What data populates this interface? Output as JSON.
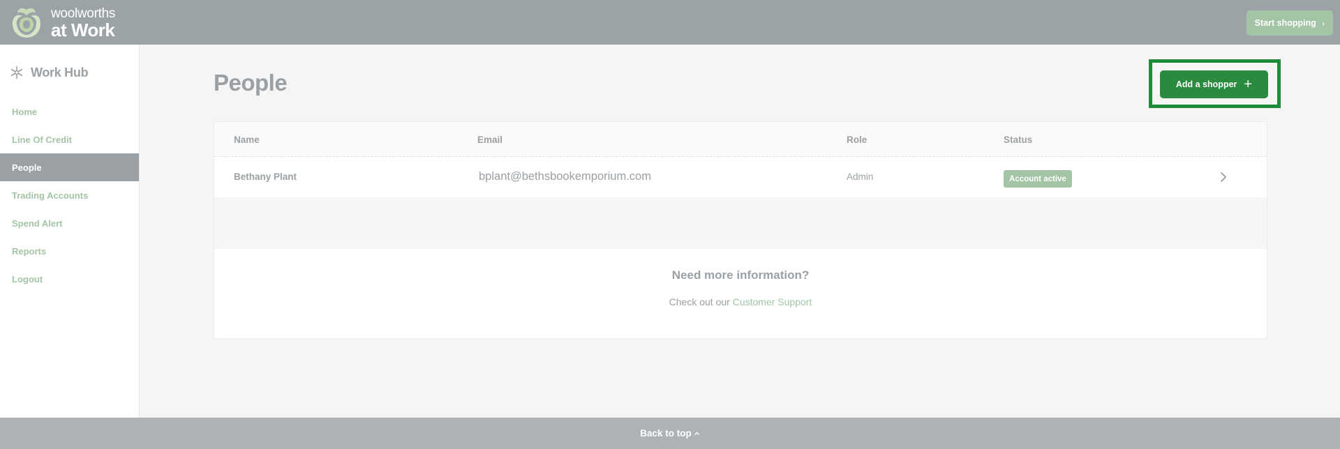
{
  "header": {
    "logo_line1": "woolworths",
    "logo_line2": "at Work",
    "start_shopping_label": "Start shopping",
    "brand_colors": {
      "header_bg": "#9ca3a6",
      "accent": "#a3c4a5"
    }
  },
  "sidebar": {
    "hub_label": "Work Hub",
    "hub_icon": "hub-icon",
    "items": [
      {
        "label": "Home",
        "active": false
      },
      {
        "label": "Line Of Credit",
        "active": false
      },
      {
        "label": "People",
        "active": true
      },
      {
        "label": "Trading Accounts",
        "active": false
      },
      {
        "label": "Spend Alert",
        "active": false
      },
      {
        "label": "Reports",
        "active": false
      },
      {
        "label": "Logout",
        "active": false
      }
    ]
  },
  "main": {
    "title": "People",
    "add_shopper_label": "Add a shopper",
    "add_shopper_icon": "plus-icon",
    "highlight_color": "#1f8a3a",
    "table": {
      "columns": [
        "Name",
        "Email",
        "Role",
        "Status"
      ],
      "rows": [
        {
          "name": "Bethany Plant",
          "email": "bplant@bethsbookemporium.com",
          "role": "Admin",
          "status": "Account active"
        }
      ]
    },
    "info": {
      "title": "Need more information?",
      "text_prefix": "Check out our ",
      "link_label": "Customer Support"
    }
  },
  "footer": {
    "back_to_top_label": "Back to top",
    "back_to_top_icon": "chevron-up-icon"
  }
}
